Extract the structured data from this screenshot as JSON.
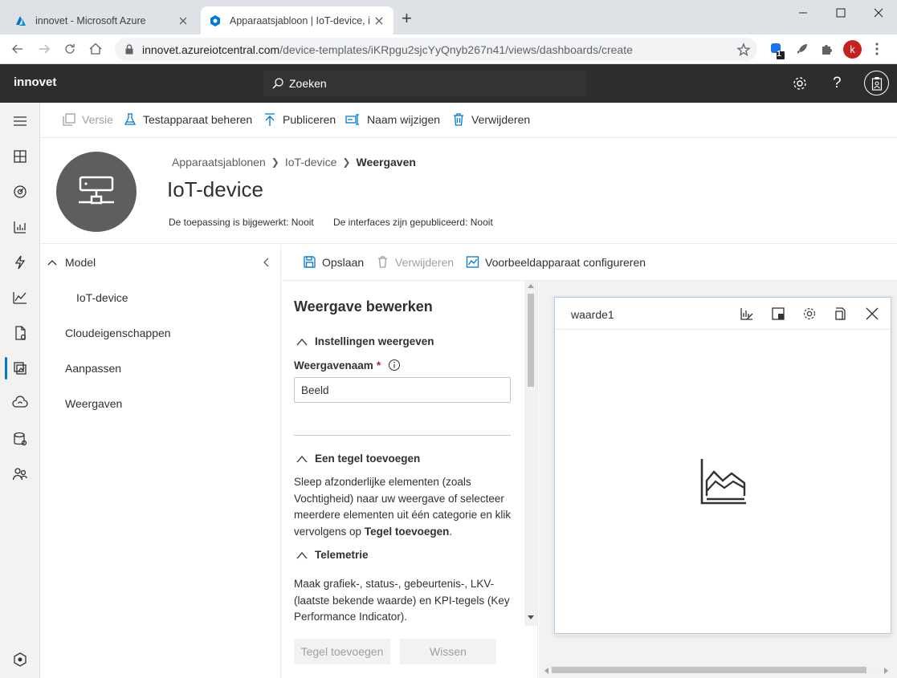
{
  "browser": {
    "tabs": [
      {
        "title": "innovet - Microsoft Azure",
        "active": false
      },
      {
        "title": "Apparaatsjabloon | IoT-device, in",
        "active": true
      }
    ],
    "new_tab": "+",
    "url_host": "innovet.azureiotcentral.com",
    "url_path": "/device-templates/iKRpgu2sjcYyQnyb267n41/views/dashboards/create",
    "profile_initial": "k",
    "extension_badge": "1"
  },
  "app": {
    "brand": "innovet",
    "search_label": "Zoeken"
  },
  "commands": {
    "version": "Versie",
    "test_device": "Testapparaat beheren",
    "publish": "Publiceren",
    "rename": "Naam wijzigen",
    "delete": "Verwijderen"
  },
  "page": {
    "breadcrumbs": [
      "Apparaatsjablonen",
      "IoT-device",
      "Weergaven"
    ],
    "title": "IoT-device",
    "app_updated": "De toepassing is bijgewerkt: Nooit",
    "interfaces_published": "De interfaces zijn gepubliceerd: Nooit"
  },
  "tree": {
    "model": "Model",
    "model_child": "IoT-device",
    "cloud_props": "Cloudeigenschappen",
    "customize": "Aanpassen",
    "views": "Weergaven"
  },
  "subbar": {
    "save": "Opslaan",
    "delete": "Verwijderen",
    "configure": "Voorbeeldapparaat configureren"
  },
  "edit": {
    "heading": "Weergave bewerken",
    "settings_section": "Instellingen weergeven",
    "name_label": "Weergavenaam",
    "required_mark": "*",
    "name_value": "Beeld",
    "add_tile_section": "Een tegel toevoegen",
    "add_tile_text_1": "Sleep afzonderlijke elementen (zoals Vochtigheid) naar uw weergave of selecteer meerdere elementen uit één categorie en klik vervolgens op",
    "add_tile_text_bold": "Tegel toevoegen",
    "add_tile_text_end": ".",
    "telemetry_section": "Telemetrie",
    "telemetry_text": "Maak grafiek-, status-, gebeurtenis-, LKV- (laatste bekende waarde) en KPI-tegels (Key Performance Indicator).",
    "add_tile_button": "Tegel toevoegen",
    "clear_button": "Wissen"
  },
  "tile": {
    "title": "waarde1",
    "chart_icon": "area-chart-icon"
  },
  "colors": {
    "accent": "#0078d4",
    "header_bg": "#2d2d2d"
  }
}
